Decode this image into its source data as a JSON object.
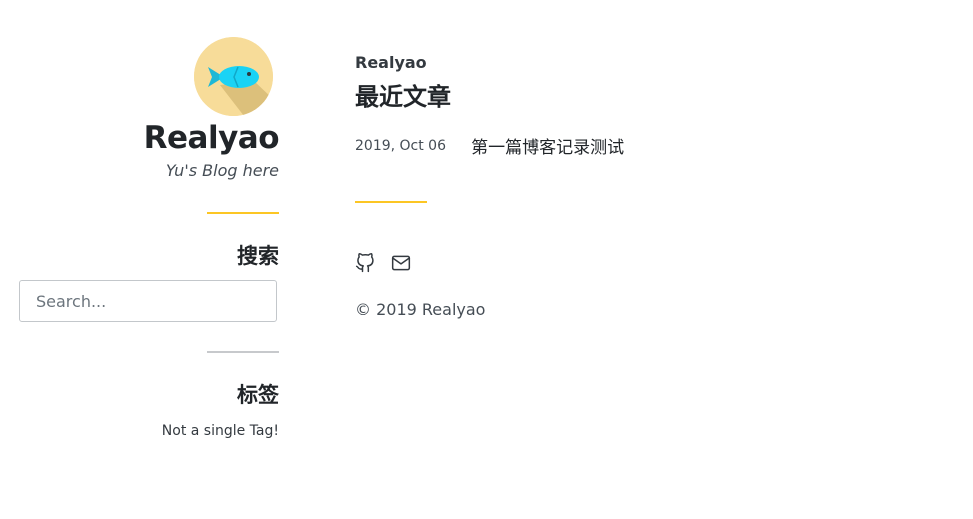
{
  "sidebar": {
    "site_title": "Realyao",
    "site_subtitle": "Yu's Blog here",
    "search_heading": "搜索",
    "search_placeholder": "Search...",
    "tags_heading": "标签",
    "tags_empty": "Not a single Tag!",
    "accent_color": "#fcc624"
  },
  "main": {
    "kicker": "Realyao",
    "title": "最近文章",
    "posts": [
      {
        "date": "2019, Oct 06",
        "title": "第一篇博客记录测试"
      }
    ],
    "social": [
      {
        "icon": "github-icon"
      },
      {
        "icon": "mail-icon"
      }
    ],
    "copyright": "© 2019 Realyao"
  }
}
